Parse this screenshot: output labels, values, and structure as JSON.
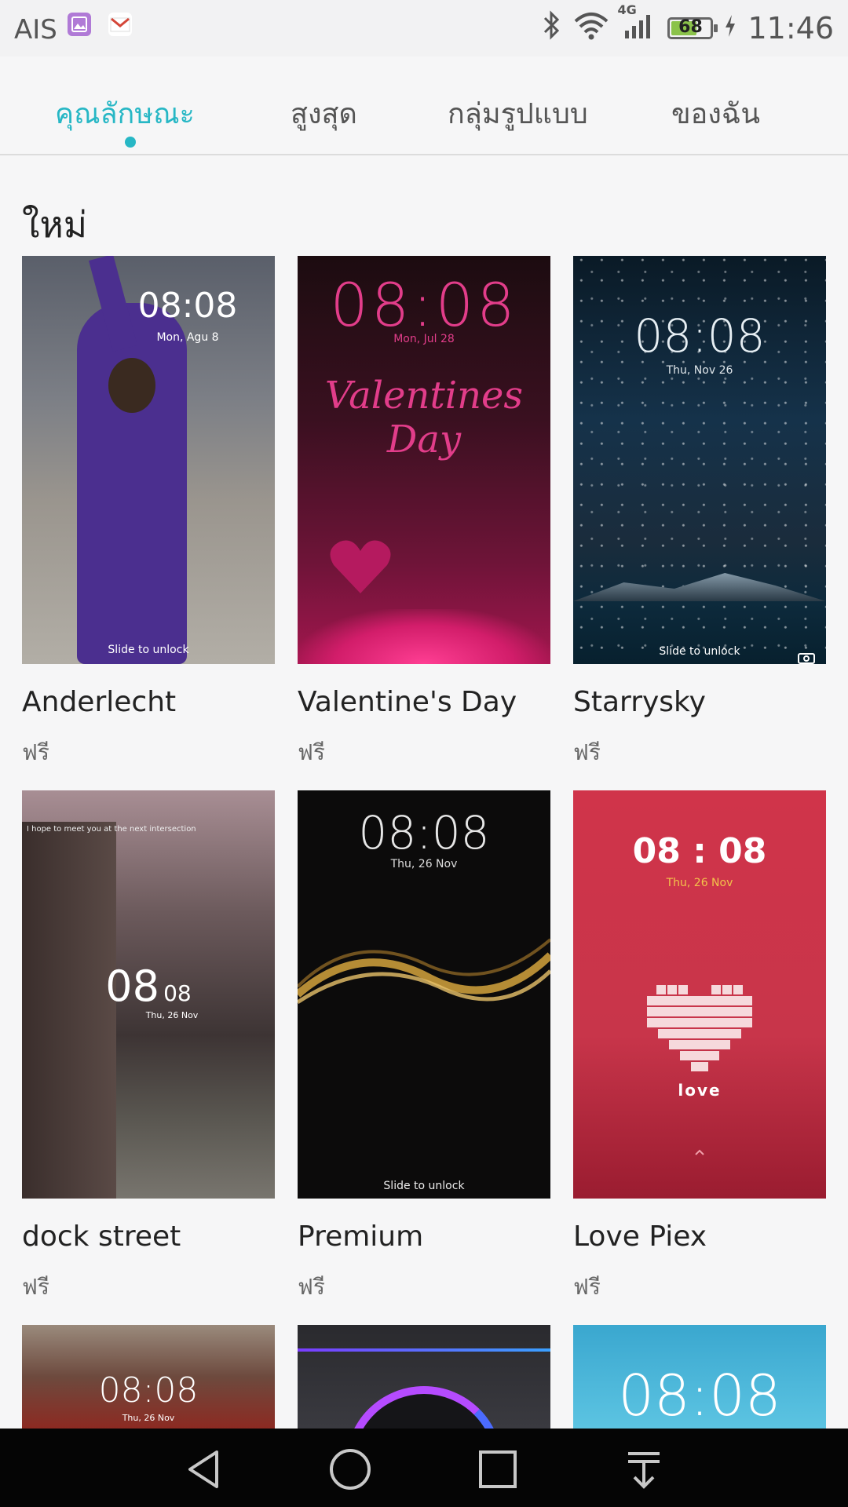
{
  "status_bar": {
    "carrier": "AIS",
    "network": "4G",
    "battery": "68",
    "battery_level": 0.68,
    "time": "11:46"
  },
  "tabs": [
    {
      "label": "คุณลักษณะ",
      "active": true
    },
    {
      "label": "สูงสุด",
      "active": false
    },
    {
      "label": "กลุ่มรูปแบบ",
      "active": false
    },
    {
      "label": "ของฉัน",
      "active": false
    }
  ],
  "section": {
    "title": "ใหม่"
  },
  "themes": [
    {
      "name": "Anderlecht",
      "price": "ฟรี",
      "clock": "08:08",
      "date": "Mon, Agu 8",
      "hint": "Slide to unlock"
    },
    {
      "name": "Valentine's Day",
      "price": "ฟรี",
      "clock": "08:08",
      "date": "Mon, Jul 28",
      "art": "Valentines Day"
    },
    {
      "name": "Starrysky",
      "price": "ฟรี",
      "clock": "08:08",
      "date": "Thu, Nov 26",
      "hint": "Slide to unlock"
    },
    {
      "name": "dock street",
      "price": "ฟรี",
      "clock": "08",
      "clock_b": "08",
      "date": "Thu, 26 Nov",
      "quote": "I hope to meet you at the next intersection"
    },
    {
      "name": "Premium",
      "price": "ฟรี",
      "clock": "08:08",
      "date": "Thu, 26 Nov",
      "hint": "Slide to unlock"
    },
    {
      "name": "Love Piex",
      "price": "ฟรี",
      "clock": "08 : 08",
      "date": "Thu, 26 Nov",
      "art": "love"
    },
    {
      "clock": "08:08",
      "date": "Thu, 26 Nov"
    },
    {},
    {
      "clock": "08:08"
    }
  ],
  "colors": {
    "accent": "#27b7c5",
    "background": "#f6f6f7",
    "navbar": "#050505"
  },
  "nav": {
    "back_icon": "back-icon",
    "home_icon": "home-icon",
    "recents_icon": "recents-icon",
    "notifications_icon": "notification-pull-icon"
  }
}
